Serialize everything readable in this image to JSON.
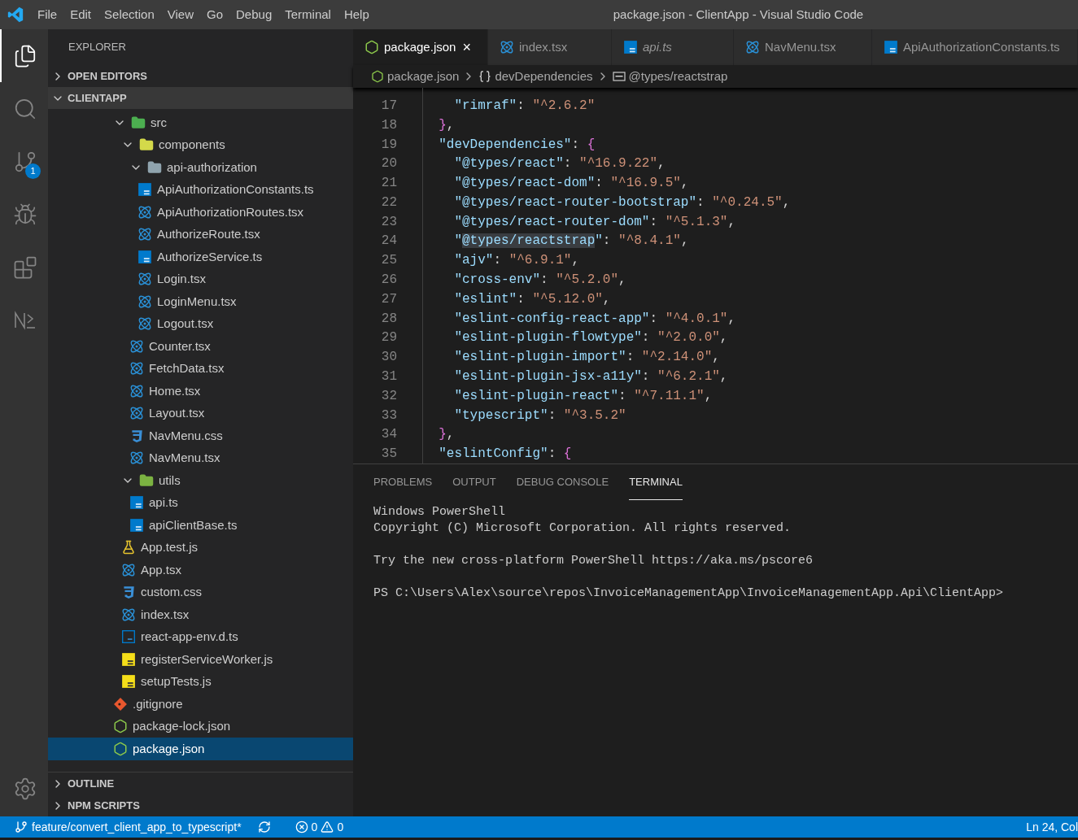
{
  "title_bar": {
    "menu": [
      "File",
      "Edit",
      "Selection",
      "View",
      "Go",
      "Debug",
      "Terminal",
      "Help"
    ],
    "title": "package.json - ClientApp - Visual Studio Code"
  },
  "activity_bar": {
    "items": [
      {
        "kind": "explorer",
        "selected": true
      },
      {
        "kind": "search",
        "selected": false
      },
      {
        "kind": "source-control",
        "selected": false,
        "badge": "1"
      },
      {
        "kind": "debug",
        "selected": false
      },
      {
        "kind": "extensions",
        "selected": false
      },
      {
        "kind": "notebook",
        "selected": false
      }
    ],
    "bottom": [
      {
        "kind": "settings",
        "selected": false
      }
    ]
  },
  "sidebar": {
    "title": "EXPLORER",
    "sections": [
      {
        "label": "OPEN EDITORS",
        "expanded": false
      },
      {
        "label": "CLIENTAPP",
        "expanded": true,
        "tree": [
          {
            "name": "src",
            "kind": "src-folder",
            "expanded": true,
            "selected": false,
            "children": [
              {
                "name": "components",
                "kind": "components-folder",
                "expanded": true,
                "selected": false,
                "children": [
                  {
                    "name": "api-authorization",
                    "kind": "folder",
                    "expanded": true,
                    "selected": false,
                    "children": [
                      {
                        "name": "ApiAuthorizationConstants.ts",
                        "kind": "ts",
                        "selected": false
                      },
                      {
                        "name": "ApiAuthorizationRoutes.tsx",
                        "kind": "react",
                        "selected": false
                      },
                      {
                        "name": "AuthorizeRoute.tsx",
                        "kind": "react",
                        "selected": false
                      },
                      {
                        "name": "AuthorizeService.ts",
                        "kind": "ts",
                        "selected": false
                      },
                      {
                        "name": "Login.tsx",
                        "kind": "react",
                        "selected": false
                      },
                      {
                        "name": "LoginMenu.tsx",
                        "kind": "react",
                        "selected": false
                      },
                      {
                        "name": "Logout.tsx",
                        "kind": "react",
                        "selected": false
                      }
                    ]
                  },
                  {
                    "name": "Counter.tsx",
                    "kind": "react",
                    "selected": false
                  },
                  {
                    "name": "FetchData.tsx",
                    "kind": "react",
                    "selected": false
                  },
                  {
                    "name": "Home.tsx",
                    "kind": "react",
                    "selected": false
                  },
                  {
                    "name": "Layout.tsx",
                    "kind": "react",
                    "selected": false
                  },
                  {
                    "name": "NavMenu.css",
                    "kind": "css",
                    "selected": false
                  },
                  {
                    "name": "NavMenu.tsx",
                    "kind": "react",
                    "selected": false
                  }
                ]
              },
              {
                "name": "utils",
                "kind": "utils-folder",
                "expanded": true,
                "selected": false,
                "children": [
                  {
                    "name": "api.ts",
                    "kind": "ts",
                    "selected": false
                  },
                  {
                    "name": "apiClientBase.ts",
                    "kind": "ts",
                    "selected": false
                  }
                ]
              },
              {
                "name": "App.test.js",
                "kind": "test",
                "selected": false
              },
              {
                "name": "App.tsx",
                "kind": "react",
                "selected": false
              },
              {
                "name": "custom.css",
                "kind": "css",
                "selected": false
              },
              {
                "name": "index.tsx",
                "kind": "react",
                "selected": false
              },
              {
                "name": "react-app-env.d.ts",
                "kind": "declaration",
                "selected": false
              },
              {
                "name": "registerServiceWorker.js",
                "kind": "js",
                "selected": false
              },
              {
                "name": "setupTests.js",
                "kind": "js",
                "selected": false
              }
            ]
          },
          {
            "name": ".gitignore",
            "kind": "git",
            "selected": false
          },
          {
            "name": "package-lock.json",
            "kind": "json",
            "selected": false
          },
          {
            "name": "package.json",
            "kind": "json",
            "selected": true
          }
        ]
      }
    ],
    "bottom_sections": [
      {
        "label": "OUTLINE",
        "expanded": false
      },
      {
        "label": "NPM SCRIPTS",
        "expanded": false
      }
    ]
  },
  "tabs": [
    {
      "label": "package.json",
      "kind": "json",
      "selected": true,
      "preview": false,
      "close": "×"
    },
    {
      "label": "index.tsx",
      "kind": "react",
      "selected": false,
      "preview": false
    },
    {
      "label": "api.ts",
      "kind": "ts",
      "selected": false,
      "preview": true
    },
    {
      "label": "NavMenu.tsx",
      "kind": "react",
      "selected": false,
      "preview": false
    },
    {
      "label": "ApiAuthorizationConstants.ts",
      "kind": "ts",
      "selected": false,
      "preview": false
    }
  ],
  "breadcrumbs": [
    {
      "kind": "json",
      "text": "package.json"
    },
    {
      "kind": "object",
      "text": "devDependencies"
    },
    {
      "kind": "string",
      "text": "@types/reactstrap"
    }
  ],
  "editor": {
    "lines": [
      {
        "number": "17",
        "tokens": [
          {
            "kind": "key",
            "text": "    \"rimraf\""
          },
          {
            "kind": "punct",
            "text": ": "
          },
          {
            "kind": "string",
            "text": "\"^2.6.2\""
          }
        ]
      },
      {
        "number": "18",
        "tokens": [
          {
            "kind": "brace",
            "text": "  }"
          },
          {
            "kind": "punct",
            "text": ","
          }
        ]
      },
      {
        "number": "19",
        "tokens": [
          {
            "kind": "key",
            "text": "  \"devDependencies\""
          },
          {
            "kind": "punct",
            "text": ": "
          },
          {
            "kind": "brace",
            "text": "{"
          }
        ]
      },
      {
        "number": "20",
        "tokens": [
          {
            "kind": "key",
            "text": "    \"@types/react\""
          },
          {
            "kind": "punct",
            "text": ": "
          },
          {
            "kind": "string",
            "text": "\"^16.9.22\""
          },
          {
            "kind": "punct",
            "text": ","
          }
        ]
      },
      {
        "number": "21",
        "tokens": [
          {
            "kind": "key",
            "text": "    \"@types/react-dom\""
          },
          {
            "kind": "punct",
            "text": ": "
          },
          {
            "kind": "string",
            "text": "\"^16.9.5\""
          },
          {
            "kind": "punct",
            "text": ","
          }
        ]
      },
      {
        "number": "22",
        "tokens": [
          {
            "kind": "key",
            "text": "    \"@types/react-router-bootstrap\""
          },
          {
            "kind": "punct",
            "text": ": "
          },
          {
            "kind": "string",
            "text": "\"^0.24.5\""
          },
          {
            "kind": "punct",
            "text": ","
          }
        ]
      },
      {
        "number": "23",
        "tokens": [
          {
            "kind": "key",
            "text": "    \"@types/react-router-dom\""
          },
          {
            "kind": "punct",
            "text": ": "
          },
          {
            "kind": "string",
            "text": "\"^5.1.3\""
          },
          {
            "kind": "punct",
            "text": ","
          }
        ]
      },
      {
        "number": "24",
        "tokens": [
          {
            "kind": "key",
            "text": "    \""
          },
          {
            "kind": "key-highlight",
            "text": "@types/reactstrap"
          },
          {
            "kind": "key",
            "text": "\""
          },
          {
            "kind": "punct",
            "text": ": "
          },
          {
            "kind": "string",
            "text": "\"^8.4.1\""
          },
          {
            "kind": "punct",
            "text": ","
          }
        ]
      },
      {
        "number": "25",
        "tokens": [
          {
            "kind": "key",
            "text": "    \"ajv\""
          },
          {
            "kind": "punct",
            "text": ": "
          },
          {
            "kind": "string",
            "text": "\"^6.9.1\""
          },
          {
            "kind": "punct",
            "text": ","
          }
        ]
      },
      {
        "number": "26",
        "tokens": [
          {
            "kind": "key",
            "text": "    \"cross-env\""
          },
          {
            "kind": "punct",
            "text": ": "
          },
          {
            "kind": "string",
            "text": "\"^5.2.0\""
          },
          {
            "kind": "punct",
            "text": ","
          }
        ]
      },
      {
        "number": "27",
        "tokens": [
          {
            "kind": "key",
            "text": "    \"eslint\""
          },
          {
            "kind": "punct",
            "text": ": "
          },
          {
            "kind": "string",
            "text": "\"^5.12.0\""
          },
          {
            "kind": "punct",
            "text": ","
          }
        ]
      },
      {
        "number": "28",
        "tokens": [
          {
            "kind": "key",
            "text": "    \"eslint-config-react-app\""
          },
          {
            "kind": "punct",
            "text": ": "
          },
          {
            "kind": "string",
            "text": "\"^4.0.1\""
          },
          {
            "kind": "punct",
            "text": ","
          }
        ]
      },
      {
        "number": "29",
        "tokens": [
          {
            "kind": "key",
            "text": "    \"eslint-plugin-flowtype\""
          },
          {
            "kind": "punct",
            "text": ": "
          },
          {
            "kind": "string",
            "text": "\"^2.0.0\""
          },
          {
            "kind": "punct",
            "text": ","
          }
        ]
      },
      {
        "number": "30",
        "tokens": [
          {
            "kind": "key",
            "text": "    \"eslint-plugin-import\""
          },
          {
            "kind": "punct",
            "text": ": "
          },
          {
            "kind": "string",
            "text": "\"^2.14.0\""
          },
          {
            "kind": "punct",
            "text": ","
          }
        ]
      },
      {
        "number": "31",
        "tokens": [
          {
            "kind": "key",
            "text": "    \"eslint-plugin-jsx-a11y\""
          },
          {
            "kind": "punct",
            "text": ": "
          },
          {
            "kind": "string",
            "text": "\"^6.2.1\""
          },
          {
            "kind": "punct",
            "text": ","
          }
        ]
      },
      {
        "number": "32",
        "tokens": [
          {
            "kind": "key",
            "text": "    \"eslint-plugin-react\""
          },
          {
            "kind": "punct",
            "text": ": "
          },
          {
            "kind": "string",
            "text": "\"^7.11.1\""
          },
          {
            "kind": "punct",
            "text": ","
          }
        ]
      },
      {
        "number": "33",
        "tokens": [
          {
            "kind": "key",
            "text": "    \"typescript\""
          },
          {
            "kind": "punct",
            "text": ": "
          },
          {
            "kind": "string",
            "text": "\"^3.5.2\""
          }
        ]
      },
      {
        "number": "34",
        "tokens": [
          {
            "kind": "brace",
            "text": "  }"
          },
          {
            "kind": "punct",
            "text": ","
          }
        ]
      },
      {
        "number": "35",
        "tokens": [
          {
            "kind": "key",
            "text": "  \"eslintConfig\""
          },
          {
            "kind": "punct",
            "text": ": "
          },
          {
            "kind": "brace",
            "text": "{"
          }
        ]
      }
    ]
  },
  "panel": {
    "tabs": [
      {
        "label": "PROBLEMS",
        "selected": false
      },
      {
        "label": "OUTPUT",
        "selected": false
      },
      {
        "label": "DEBUG CONSOLE",
        "selected": false
      },
      {
        "label": "TERMINAL",
        "selected": true
      }
    ],
    "terminal": {
      "blocks": [
        {
          "lines": [
            "Windows PowerShell",
            "Copyright (C) Microsoft Corporation. All rights reserved."
          ]
        },
        {
          "lines": [
            "Try the new cross-platform PowerShell https://aka.ms/pscore6"
          ]
        },
        {
          "lines": [
            "PS C:\\Users\\Alex\\source\\repos\\InvoiceManagementApp\\InvoiceManagementApp.Api\\ClientApp>"
          ]
        }
      ]
    }
  },
  "status_bar": {
    "branch": "feature/convert_client_app_to_typescript*",
    "errors": "0",
    "warnings": "0",
    "position": "Ln 24, Col"
  }
}
